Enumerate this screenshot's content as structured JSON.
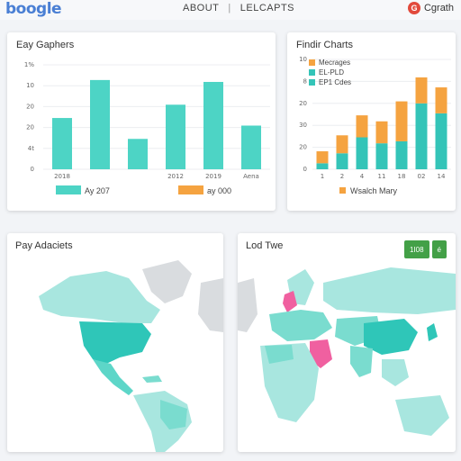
{
  "header": {
    "logo_text": "boogle",
    "nav": [
      "ABOUT",
      "LELCAPTS"
    ],
    "user_label": "Cgrath",
    "user_icon": "google-g-icon"
  },
  "cards": {
    "bar_title": "Eay Gaphers",
    "stack_title": "Findir Charts",
    "map1_title": "Pay Adaciets",
    "map2_title": "Lod Twe",
    "map2_buttons": [
      "1I08",
      "é"
    ]
  },
  "chart_data": [
    {
      "type": "bar",
      "title": "Eay Gaphers",
      "categories": [
        "2018",
        "",
        "2012",
        "2019",
        "Aena"
      ],
      "y_ticks": [
        "0",
        "4t",
        "20",
        "20",
        "10",
        "1%"
      ],
      "series": [
        {
          "name": "Ay 207",
          "values": [
            27,
            47,
            16,
            34,
            46,
            23
          ],
          "color": "#4dd4c5"
        }
      ],
      "secondary_legend": {
        "name": "ay 000",
        "color": "#f5a340"
      },
      "ylim": [
        0,
        55
      ]
    },
    {
      "type": "bar",
      "stacked": true,
      "title": "Findir Charts",
      "categories": [
        "1",
        "2",
        "4",
        "11",
        "18",
        "02",
        "14"
      ],
      "y_ticks": [
        "0",
        "20",
        "30",
        "20",
        "8",
        "10"
      ],
      "legend": [
        "Mecrages",
        "EL-PLD",
        "EP1 Cdes"
      ],
      "series": [
        {
          "name": "teal",
          "values": [
            3,
            8,
            16,
            13,
            14,
            33,
            28
          ],
          "color": "#34c4b8"
        },
        {
          "name": "orange",
          "values": [
            6,
            9,
            11,
            11,
            20,
            13,
            13
          ],
          "color": "#f5a340"
        }
      ],
      "bottom_legend": "Wsalch Mary",
      "ylim": [
        0,
        55
      ]
    }
  ],
  "colors": {
    "teal": "#4dd4c5",
    "teal_light": "#a8e6df",
    "orange": "#f5a340",
    "pink": "#f060a0",
    "green_btn": "#43a047"
  }
}
